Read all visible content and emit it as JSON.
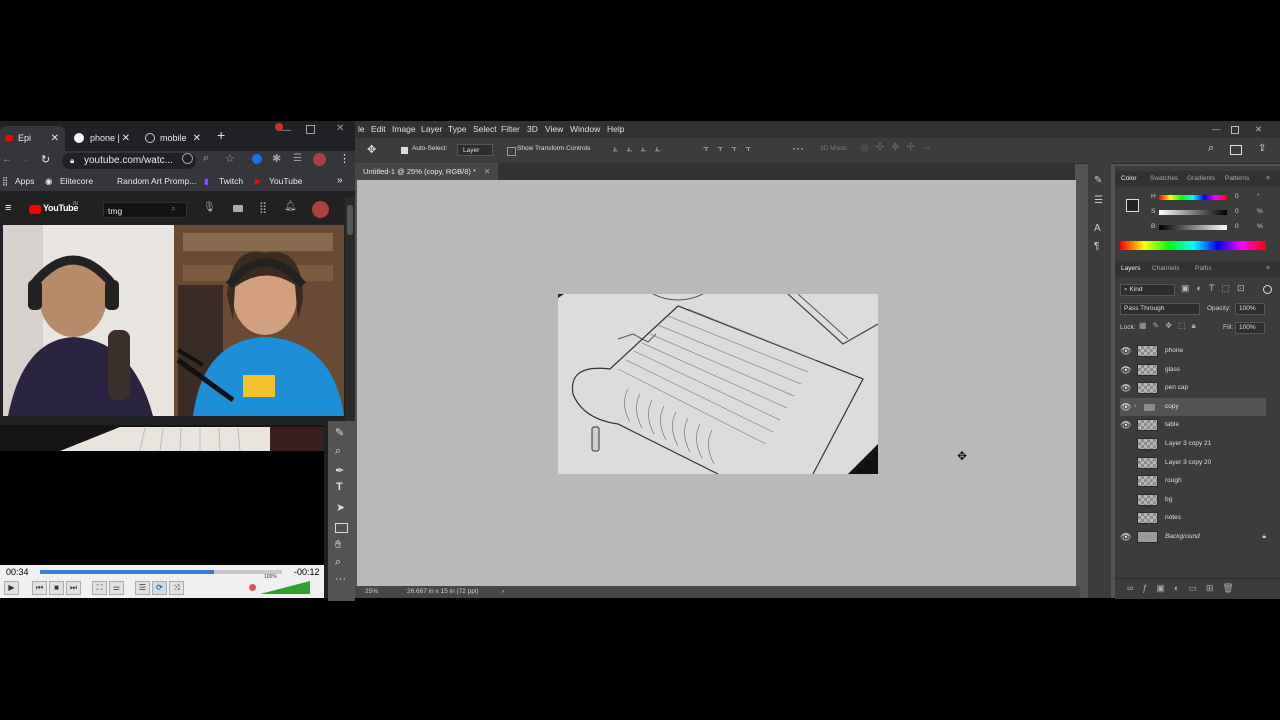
{
  "chrome": {
    "tabs": [
      {
        "label": "Epi"
      },
      {
        "label": "phone |"
      },
      {
        "label": "mobile"
      }
    ],
    "url": "youtube.com/watc...",
    "bookmarks": [
      "Apps",
      "Elitecore",
      "Random Art Promp...",
      "Twitch",
      "YouTube"
    ]
  },
  "youtube": {
    "logo": "YouTube",
    "logo_sup": "IN",
    "search_value": "tmg"
  },
  "player": {
    "elapsed": "00:34",
    "remaining": "-00:12",
    "progress": 0.72,
    "volume_label": "100%"
  },
  "photoshop": {
    "menu": [
      "le",
      "Edit",
      "Image",
      "Layer",
      "Type",
      "Select",
      "Filter",
      "3D",
      "View",
      "Window",
      "Help"
    ],
    "options": {
      "auto_select": "Auto-Select:",
      "auto_select_target": "Layer",
      "show_transform": "Show Transform Controls",
      "mode_3d": "3D Mode:"
    },
    "doc_tab": "Untitled-1 @ 25% (copy, RGB/8) *",
    "status_zoom": "25%",
    "status_doc": "26.667 in x 15 in (72 ppi)",
    "color_panel": {
      "tabs": [
        "Color",
        "Swatches",
        "Gradients",
        "Patterns"
      ],
      "channels": [
        {
          "label": "H",
          "value": "0",
          "unit": "°"
        },
        {
          "label": "S",
          "value": "0",
          "unit": "%"
        },
        {
          "label": "B",
          "value": "0",
          "unit": "%"
        }
      ]
    },
    "layers_panel": {
      "tabs": [
        "Layers",
        "Channels",
        "Paths"
      ],
      "filter": "Kind",
      "blend_mode": "Pass Through",
      "opacity_label": "Opacity:",
      "opacity_value": "100%",
      "lock_label": "Lock:",
      "fill_label": "Fill:",
      "fill_value": "100%",
      "layers": [
        {
          "name": "phone",
          "visible": true
        },
        {
          "name": "glass",
          "visible": true
        },
        {
          "name": "pen cap",
          "visible": true
        },
        {
          "name": "copy",
          "visible": true,
          "group": true,
          "selected": true
        },
        {
          "name": "table",
          "visible": true
        },
        {
          "name": "Layer 3 copy 21",
          "visible": false
        },
        {
          "name": "Layer 3 copy 20",
          "visible": false
        },
        {
          "name": "rough",
          "visible": false
        },
        {
          "name": "bg",
          "visible": false
        },
        {
          "name": "notes",
          "visible": false
        },
        {
          "name": "Background",
          "visible": true,
          "locked": true
        }
      ]
    }
  }
}
